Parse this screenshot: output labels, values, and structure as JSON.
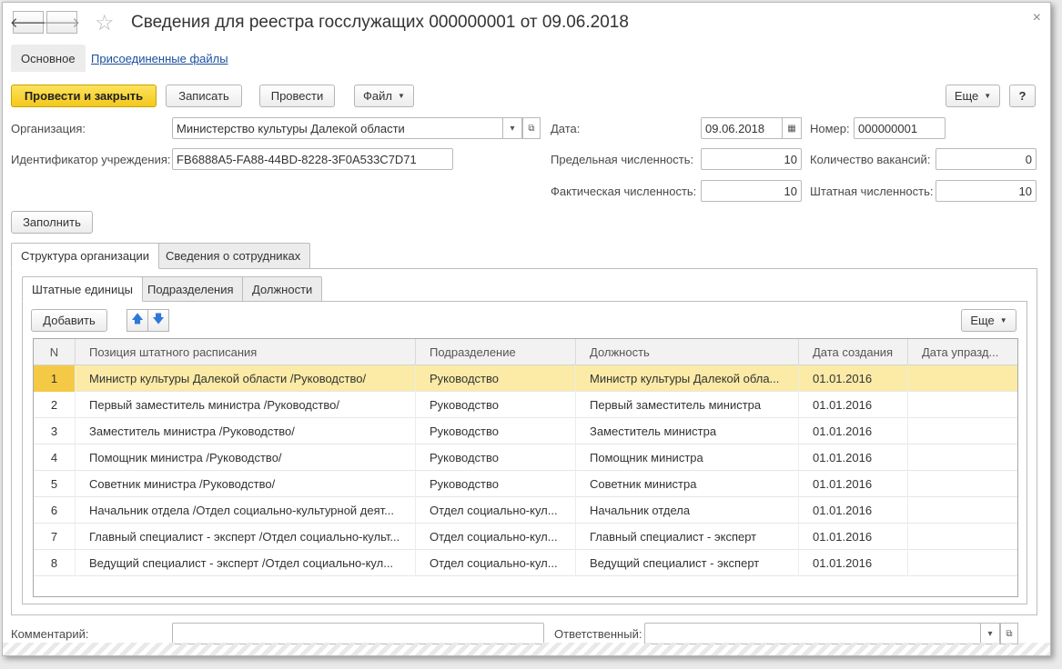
{
  "window": {
    "title": "Сведения для реестра госслужащих 000000001 от 09.06.2018",
    "nav_back": "🡐",
    "nav_forward": "🡒",
    "favorite_icon": "☆",
    "close_icon": "×"
  },
  "top_tabs": {
    "main": "Основное",
    "attached_files": "Присоединенные файлы"
  },
  "toolbar": {
    "post_and_close": "Провести и закрыть",
    "save": "Записать",
    "post": "Провести",
    "file": "Файл",
    "more": "Еще",
    "help": "?"
  },
  "form": {
    "organization_label": "Организация:",
    "organization_value": "Министерство культуры Далекой области",
    "institution_id_label": "Идентификатор учреждения:",
    "institution_id_value": "FB6888A5-FA88-44BD-8228-3F0A533C7D71",
    "date_label": "Дата:",
    "date_value": "09.06.2018",
    "number_label": "Номер:",
    "number_value": "000000001",
    "limit_count_label": "Предельная численность:",
    "limit_count_value": "10",
    "vacancies_label": "Количество вакансий:",
    "vacancies_value": "0",
    "actual_count_label": "Фактическая численность:",
    "actual_count_value": "10",
    "staff_count_label": "Штатная численность:",
    "staff_count_value": "10",
    "fill_button": "Заполнить",
    "comment_label": "Комментарий:",
    "comment_value": "",
    "responsible_label": "Ответственный:",
    "responsible_value": ""
  },
  "page_tabs": {
    "structure": "Структура организации",
    "employees": "Сведения о сотрудниках"
  },
  "sub_tabs": {
    "staff_units": "Штатные единицы",
    "departments": "Подразделения",
    "positions": "Должности"
  },
  "grid_toolbar": {
    "add": "Добавить",
    "more": "Еще"
  },
  "table": {
    "columns": [
      "N",
      "Позиция штатного расписания",
      "Подразделение",
      "Должность",
      "Дата создания",
      "Дата упразд..."
    ],
    "selected_row": 0,
    "rows": [
      [
        "1",
        "Министр культуры Далекой области /Руководство/",
        "Руководство",
        "Министр культуры Далекой обла...",
        "01.01.2016",
        ""
      ],
      [
        "2",
        "Первый заместитель министра /Руководство/",
        "Руководство",
        "Первый заместитель министра",
        "01.01.2016",
        ""
      ],
      [
        "3",
        "Заместитель министра /Руководство/",
        "Руководство",
        "Заместитель министра",
        "01.01.2016",
        ""
      ],
      [
        "4",
        "Помощник министра /Руководство/",
        "Руководство",
        "Помощник министра",
        "01.01.2016",
        ""
      ],
      [
        "5",
        "Советник министра /Руководство/",
        "Руководство",
        "Советник министра",
        "01.01.2016",
        ""
      ],
      [
        "6",
        "Начальник отдела /Отдел социально-культурной деят...",
        "Отдел социально-кул...",
        "Начальник отдела",
        "01.01.2016",
        ""
      ],
      [
        "7",
        "Главный специалист - эксперт /Отдел социально-культ...",
        "Отдел социально-кул...",
        "Главный специалист - эксперт",
        "01.01.2016",
        ""
      ],
      [
        "8",
        "Ведущий специалист - эксперт /Отдел социально-кул...",
        "Отдел социально-кул...",
        "Ведущий специалист - эксперт",
        "01.01.2016",
        ""
      ]
    ]
  },
  "colors": {
    "accent_yellow": "#f3c81c",
    "selected_row": "#fbeba6",
    "link_blue": "#1a4e9e"
  }
}
